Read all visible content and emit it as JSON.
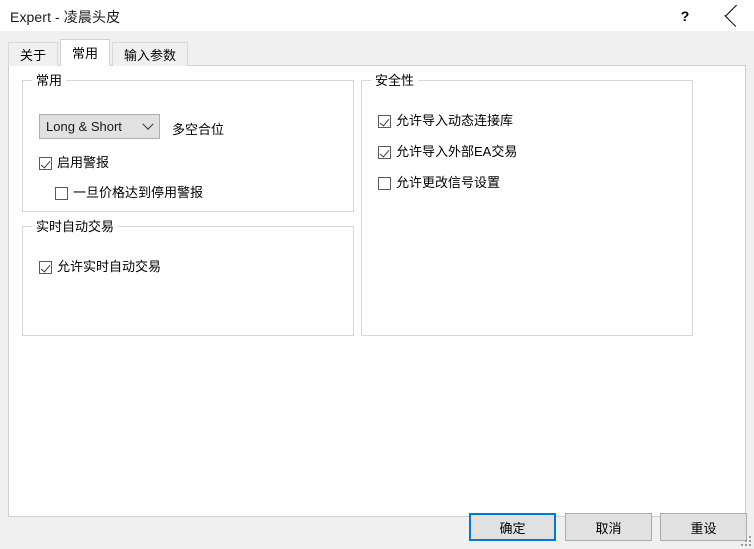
{
  "window": {
    "title": "Expert - 凌晨头皮",
    "help_icon": "question-mark-icon",
    "close_icon": "close-icon"
  },
  "tabs": [
    {
      "label": "关于",
      "active": false
    },
    {
      "label": "常用",
      "active": true
    },
    {
      "label": "输入参数",
      "active": false
    }
  ],
  "groups": {
    "general": {
      "legend": "常用",
      "combo": {
        "value": "Long & Short",
        "side_label": "多空合位",
        "arrow_icon": "chevron-down-icon"
      },
      "checkboxes": [
        {
          "label": "启用警报",
          "checked": true
        },
        {
          "label": "一旦价格达到停用警报",
          "checked": false
        }
      ]
    },
    "live_trade": {
      "legend": "实时自动交易",
      "checkboxes": [
        {
          "label": "允许实时自动交易",
          "checked": true
        }
      ]
    },
    "security": {
      "legend": "安全性",
      "checkboxes": [
        {
          "label": "允许导入动态连接库",
          "checked": true
        },
        {
          "label": "允许导入外部EA交易",
          "checked": true
        },
        {
          "label": "允许更改信号设置",
          "checked": false
        }
      ]
    }
  },
  "footer": {
    "ok": "确定",
    "cancel": "取消",
    "reset": "重设"
  },
  "colors": {
    "accent": "#0078d7",
    "dialog_bg": "#f0f0f0",
    "panel_bg": "#ffffff",
    "button_bg": "#e1e1e1",
    "border": "#d6d6d6"
  }
}
